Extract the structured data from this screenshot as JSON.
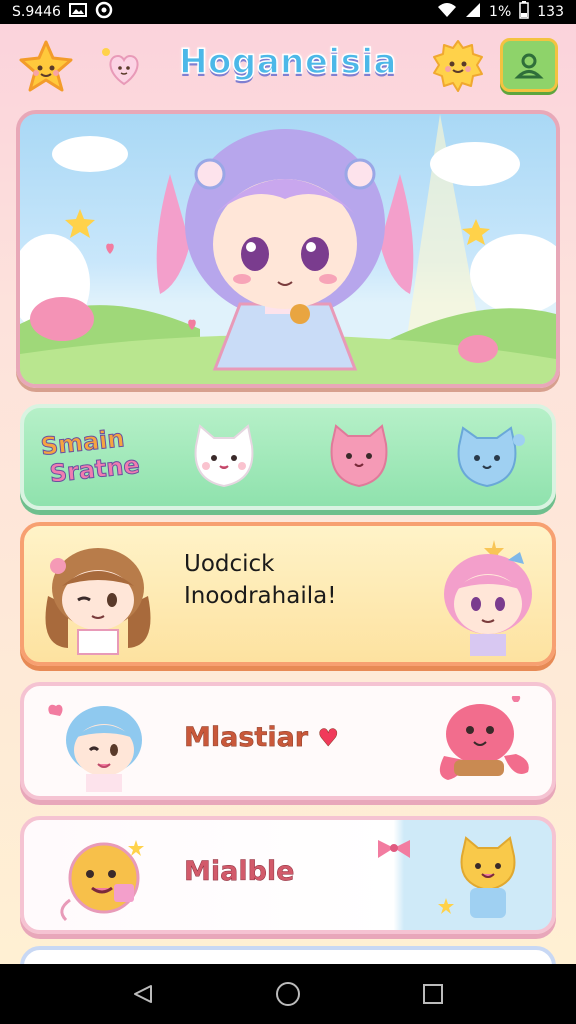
{
  "status_bar": {
    "left_text": "S.9446",
    "right_text": "1%",
    "time": "133",
    "icons": [
      "photo-icon",
      "circle-app-icon",
      "wifi-icon",
      "signal-icon",
      "battery-icon"
    ]
  },
  "header": {
    "title": "Hoganeisia",
    "left_icons": [
      "star-face-icon",
      "heart-face-icon"
    ],
    "right_icons": [
      "sun-face-icon",
      "profile-icon"
    ]
  },
  "hero": {
    "scene": "chibi-girl-banner"
  },
  "cards": [
    {
      "title_line1": "Smain",
      "title_line2": "Sratne",
      "characters": [
        "white-cat-icon",
        "pink-cat-icon",
        "blue-cat-icon"
      ]
    },
    {
      "text_line1": "Uodcick",
      "text_line2": "Inoodrahaila!",
      "characters": [
        "brown-hair-girl-icon",
        "pink-hair-girl-icon"
      ]
    },
    {
      "title": "Mlastiar",
      "characters": [
        "blue-hair-kid-icon",
        "pink-octopus-icon"
      ]
    },
    {
      "title": "Mialble",
      "characters": [
        "yellow-ball-icon",
        "yellow-cat-icon"
      ]
    }
  ],
  "colors": {
    "accent_green": "#8ed36a",
    "card_green": "#a8ebbf",
    "card_yellow": "#fde7b0",
    "card_pink_border": "#f5c3d2",
    "title_blue": "#4cb8e8"
  },
  "nav": {
    "items": [
      "back-icon",
      "home-icon",
      "recents-icon"
    ]
  }
}
